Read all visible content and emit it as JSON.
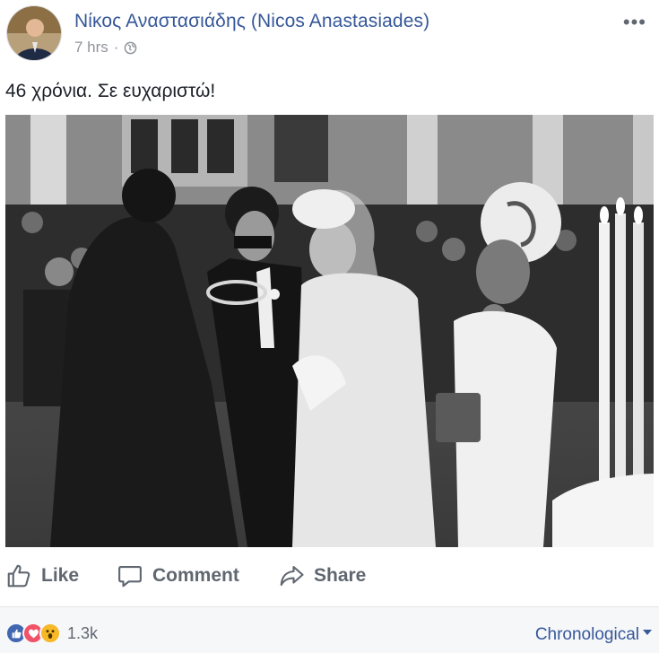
{
  "post": {
    "author": "Νίκος Αναστασιάδης (Nicos Anastasiades)",
    "timestamp": "7 hrs",
    "separator": "·",
    "privacy_icon": "globe-icon",
    "more_icon": "more-options-icon",
    "more_label": "•••",
    "caption": "46 χρόνια. Σε ευχαριστώ!",
    "photo_description_icon": "wedding-photo"
  },
  "actions": {
    "like_label": "Like",
    "comment_label": "Comment",
    "share_label": "Share"
  },
  "footer": {
    "reactions": [
      "like-reaction-icon",
      "love-reaction-icon",
      "wow-reaction-icon"
    ],
    "reaction_count": "1.3k",
    "sort_label": "Chronological"
  },
  "colors": {
    "link": "#365899",
    "secondary": "#90949c",
    "like_blue": "#4267b2",
    "love_red": "#f25268",
    "wow_yellow": "#f7b928"
  }
}
